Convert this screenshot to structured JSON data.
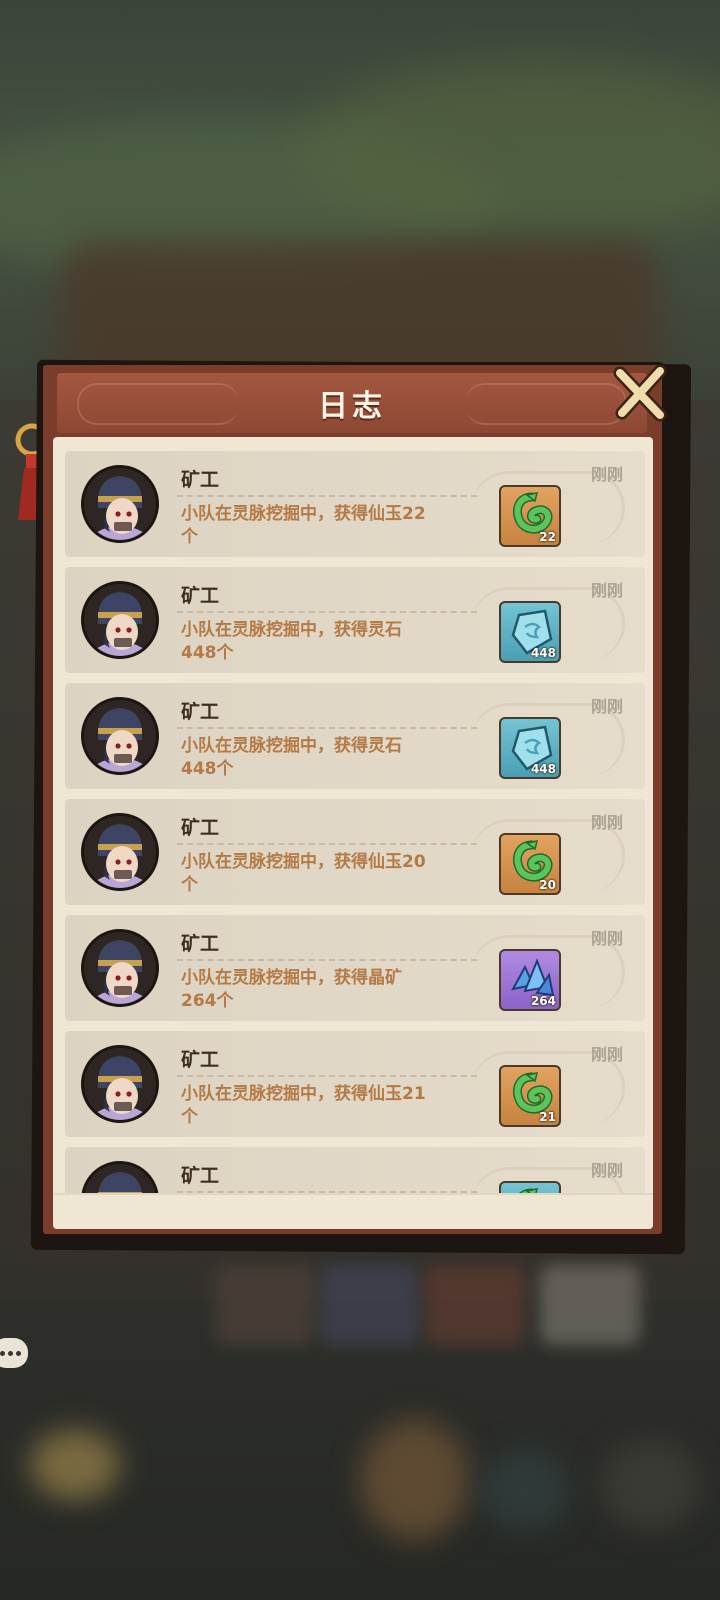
{
  "dialog": {
    "title": "日志",
    "close_icon": "close-x-icon"
  },
  "logs": [
    {
      "name": "矿工",
      "message": "小队在灵脉挖掘中，获得仙玉22个",
      "time": "刚刚",
      "reward": {
        "item": "jade-icon",
        "quantity": "22",
        "color": "#d48f4d"
      }
    },
    {
      "name": "矿工",
      "message": "小队在灵脉挖掘中，获得灵石448个",
      "time": "刚刚",
      "reward": {
        "item": "spirit-stone-icon",
        "quantity": "448",
        "color": "#5fb3c6"
      }
    },
    {
      "name": "矿工",
      "message": "小队在灵脉挖掘中，获得灵石448个",
      "time": "刚刚",
      "reward": {
        "item": "spirit-stone-icon",
        "quantity": "448",
        "color": "#5fb3c6"
      }
    },
    {
      "name": "矿工",
      "message": "小队在灵脉挖掘中，获得仙玉20个",
      "time": "刚刚",
      "reward": {
        "item": "jade-icon",
        "quantity": "20",
        "color": "#d48f4d"
      }
    },
    {
      "name": "矿工",
      "message": "小队在灵脉挖掘中，获得晶矿264个",
      "time": "刚刚",
      "reward": {
        "item": "crystal-ore-icon",
        "quantity": "264",
        "color": "#9d76d6"
      }
    },
    {
      "name": "矿工",
      "message": "小队在灵脉挖掘中，获得仙玉21个",
      "time": "刚刚",
      "reward": {
        "item": "jade-icon",
        "quantity": "21",
        "color": "#d48f4d"
      }
    },
    {
      "name": "矿工",
      "message": "",
      "time": "刚刚",
      "reward": {
        "item": "jade-icon",
        "quantity": "",
        "color": "#5fb3c6"
      }
    }
  ]
}
